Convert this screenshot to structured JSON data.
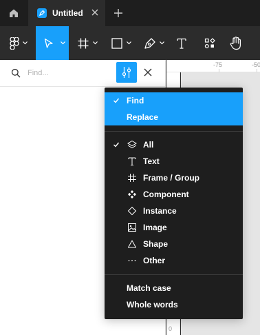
{
  "tabbar": {
    "tab_title": "Untitled"
  },
  "search": {
    "placeholder": "Find..."
  },
  "ruler": {
    "labels": [
      "-75",
      "-50"
    ],
    "vertical_label": "0"
  },
  "dropdown": {
    "mode_items": [
      {
        "label": "Find",
        "checked": true
      },
      {
        "label": "Replace",
        "checked": false
      }
    ],
    "type_items": [
      {
        "label": "All",
        "icon": "layers-icon",
        "checked": true
      },
      {
        "label": "Text",
        "icon": "text-icon",
        "checked": false
      },
      {
        "label": "Frame / Group",
        "icon": "frame-icon",
        "checked": false
      },
      {
        "label": "Component",
        "icon": "component-icon",
        "checked": false
      },
      {
        "label": "Instance",
        "icon": "instance-icon",
        "checked": false
      },
      {
        "label": "Image",
        "icon": "image-icon",
        "checked": false
      },
      {
        "label": "Shape",
        "icon": "shape-icon",
        "checked": false
      },
      {
        "label": "Other",
        "icon": "more-icon",
        "checked": false
      }
    ],
    "option_items": [
      {
        "label": "Match case",
        "checked": false
      },
      {
        "label": "Whole words",
        "checked": false
      }
    ]
  },
  "colors": {
    "accent": "#18a0fb",
    "menu_bg": "#1e1e1e",
    "toolbar_bg": "#2c2c2c"
  }
}
